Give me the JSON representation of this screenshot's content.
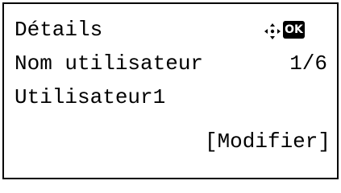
{
  "screen": {
    "title": "Détails",
    "field_label": "Nom utilisateur",
    "page_indicator": "1/6",
    "field_value": "Utilisateur1",
    "softkey_right": "[Modifier]"
  },
  "icons": {
    "navigation": "four-way-navigation-icon",
    "ok": "OK"
  },
  "colors": {
    "foreground": "#000000",
    "background": "#ffffff"
  }
}
